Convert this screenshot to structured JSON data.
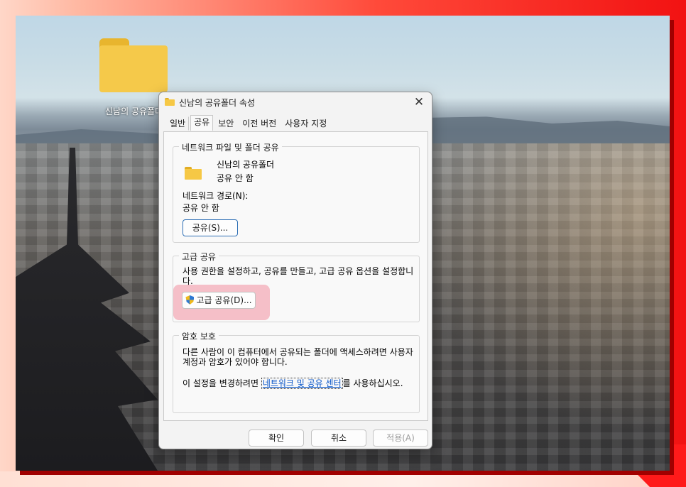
{
  "desktop": {
    "folder_icon": "folder-icon",
    "folder_label": "신남의 공유폴더"
  },
  "dialog": {
    "title": "신남의 공유폴더 속성",
    "close_symbol": "✕",
    "tabs": [
      {
        "label": "일반"
      },
      {
        "label": "공유",
        "active": true
      },
      {
        "label": "보안"
      },
      {
        "label": "이전 버전"
      },
      {
        "label": "사용자 지정"
      }
    ],
    "network_share": {
      "group_title": "네트워크 파일 및 폴더 공유",
      "folder_name": "신남의 공유폴더",
      "share_status": "공유 안 함",
      "network_path_label": "네트워크 경로(N):",
      "network_path_value": "공유 안 함",
      "share_button": "공유(S)..."
    },
    "advanced_share": {
      "group_title": "고급 공유",
      "description": "사용 권한을 설정하고, 공유를 만들고, 고급 공유 옵션을 설정합니다.",
      "button": "고급 공유(D)...",
      "button_icon": "uac-shield-icon",
      "highlight_color": "#f07a8c"
    },
    "password_protection": {
      "group_title": "암호 보호",
      "description": "다른 사람이 이 컴퓨터에서 공유되는 폴더에 액세스하려면 사용자 계정과 암호가 있어야 합니다.",
      "link_prefix": "이 설정을 변경하려면 ",
      "link_text": "네트워크 및 공유 센터",
      "link_suffix": "를 사용하십시오."
    },
    "buttons": {
      "ok": "확인",
      "cancel": "취소",
      "apply": "적용(A)"
    }
  }
}
